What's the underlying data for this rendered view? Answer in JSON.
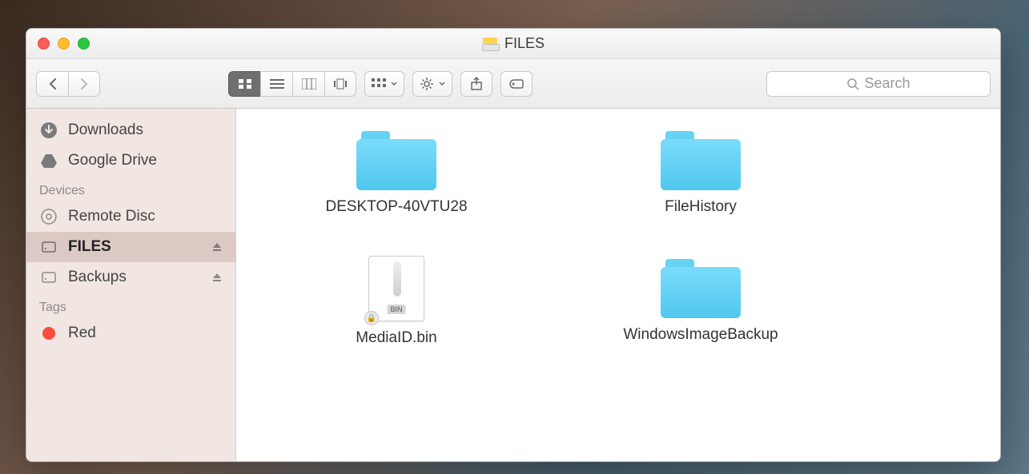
{
  "window": {
    "title": "FILES"
  },
  "toolbar": {
    "search_placeholder": "Search"
  },
  "sidebar": {
    "partial_top": [
      {
        "label": "Downloads",
        "icon": "downloads"
      },
      {
        "label": "Google Drive",
        "icon": "gdrive"
      }
    ],
    "devices_header": "Devices",
    "devices": [
      {
        "label": "Remote Disc",
        "icon": "disc",
        "eject": false,
        "selected": false
      },
      {
        "label": "FILES",
        "icon": "drive",
        "eject": true,
        "selected": true
      },
      {
        "label": "Backups",
        "icon": "drive",
        "eject": true,
        "selected": false
      }
    ],
    "tags_header": "Tags",
    "tags": [
      {
        "label": "Red",
        "color": "#ff4b3e"
      }
    ]
  },
  "items": [
    {
      "name": "DESKTOP-40VTU28",
      "type": "folder"
    },
    {
      "name": "FileHistory",
      "type": "folder"
    },
    {
      "name": "MediaID.bin",
      "type": "binfile"
    },
    {
      "name": "WindowsImageBackup",
      "type": "folder"
    }
  ],
  "binfile_tag": "BIN"
}
